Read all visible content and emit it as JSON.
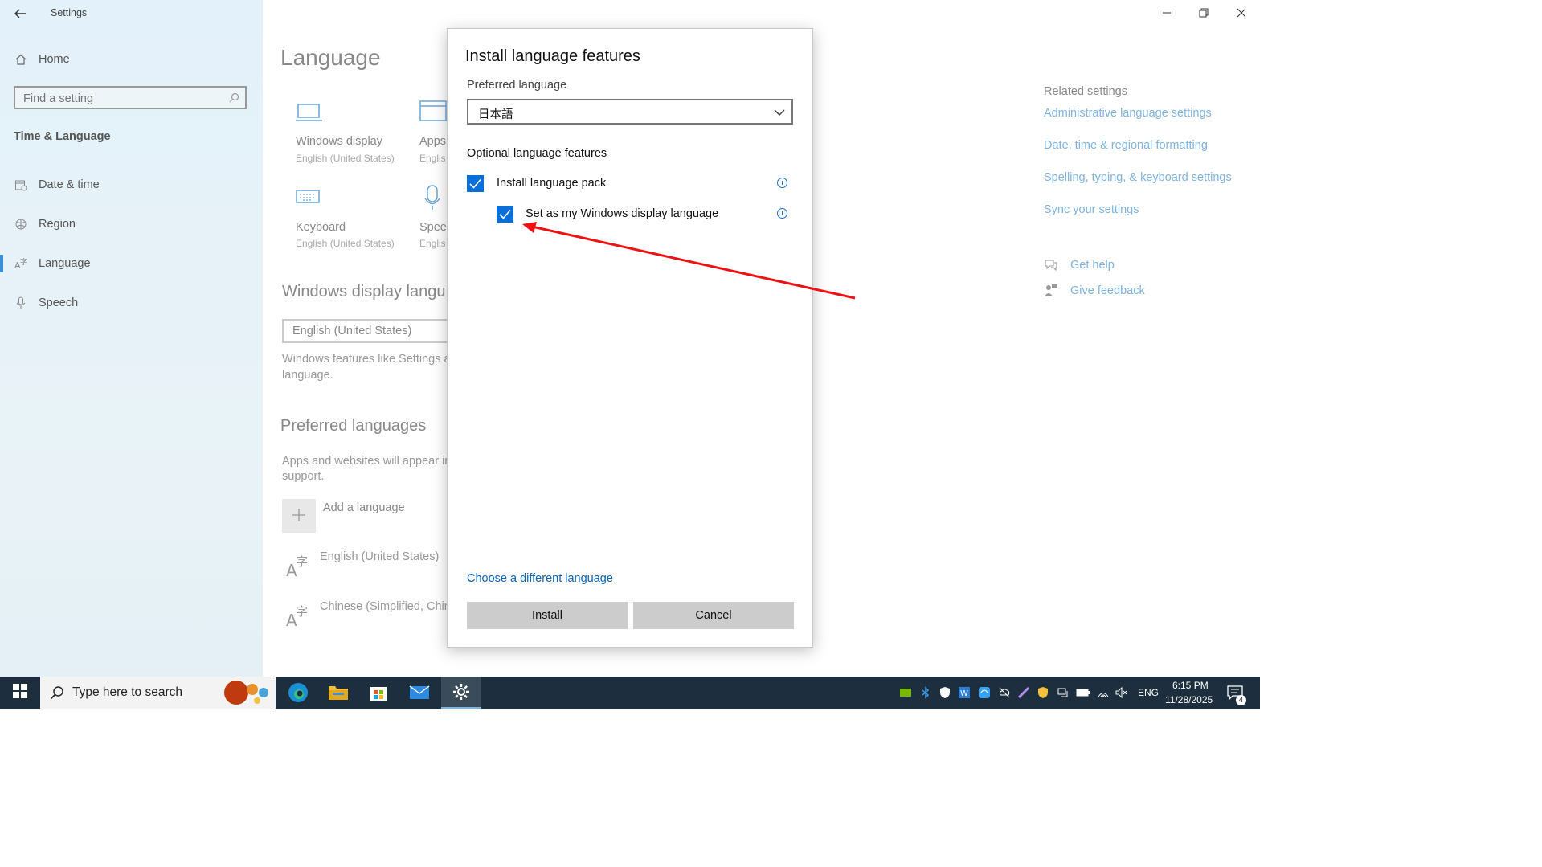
{
  "window": {
    "title": "Settings",
    "controls": {
      "minimize": "minimize-icon",
      "restore": "restore-icon",
      "close": "close-icon"
    }
  },
  "sidebar": {
    "home_label": "Home",
    "search_placeholder": "Find a setting",
    "section_title": "Time & Language",
    "items": [
      {
        "label": "Date & time",
        "icon": "calendar-clock-icon"
      },
      {
        "label": "Region",
        "icon": "globe-icon"
      },
      {
        "label": "Language",
        "icon": "language-icon",
        "selected": true
      },
      {
        "label": "Speech",
        "icon": "microphone-icon"
      }
    ]
  },
  "main": {
    "page_title": "Language",
    "tiles": [
      {
        "title": "Windows display",
        "subtitle": "English (United States)",
        "icon": "monitor-icon"
      },
      {
        "title": "Apps",
        "subtitle": "Englis",
        "icon": "window-icon"
      },
      {
        "title": "Keyboard",
        "subtitle": "English (United States)",
        "icon": "keyboard-icon"
      },
      {
        "title": "Speec",
        "subtitle": "Englis",
        "icon": "microphone-icon"
      }
    ],
    "display_lang_heading": "Windows display langu",
    "display_lang_value": "English (United States)",
    "display_lang_desc_1": "Windows features like Settings a",
    "display_lang_desc_2": "language.",
    "preferred_heading": "Preferred languages",
    "preferred_desc_1": "Apps and websites will appear in",
    "preferred_desc_2": "support.",
    "add_language": "Add a language",
    "languages": [
      "English (United States)",
      "Chinese (Simplified, Chin"
    ]
  },
  "related": {
    "heading": "Related settings",
    "links": [
      "Administrative language settings",
      "Date, time & regional formatting",
      "Spelling, typing, & keyboard settings",
      "Sync your settings"
    ],
    "help": "Get help",
    "feedback": "Give feedback"
  },
  "dialog": {
    "title": "Install language features",
    "preferred_label": "Preferred language",
    "preferred_value": "日本語",
    "optional_heading": "Optional language features",
    "options": [
      {
        "label": "Install language pack",
        "checked": true
      },
      {
        "label": "Set as my Windows display language",
        "checked": true
      }
    ],
    "choose_link": "Choose a different language",
    "install_button": "Install",
    "cancel_button": "Cancel"
  },
  "annotation": {
    "color": "#ee1111"
  },
  "taskbar": {
    "search_placeholder": "Type here to search",
    "language": "ENG",
    "time": "6:15 PM",
    "date": "11/28/2025",
    "notification_count": "4"
  }
}
